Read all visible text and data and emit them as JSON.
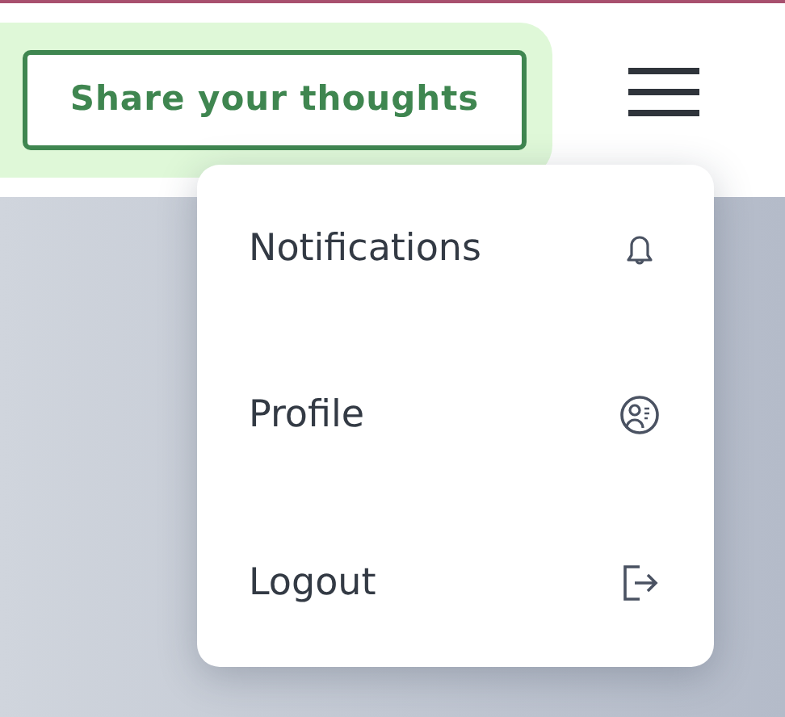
{
  "header": {
    "share_button": "Share your thoughts"
  },
  "menu": [
    {
      "label": "Notifications",
      "kind": "bell"
    },
    {
      "label": "Profile",
      "kind": "profile"
    },
    {
      "label": "Logout",
      "kind": "logout"
    }
  ]
}
